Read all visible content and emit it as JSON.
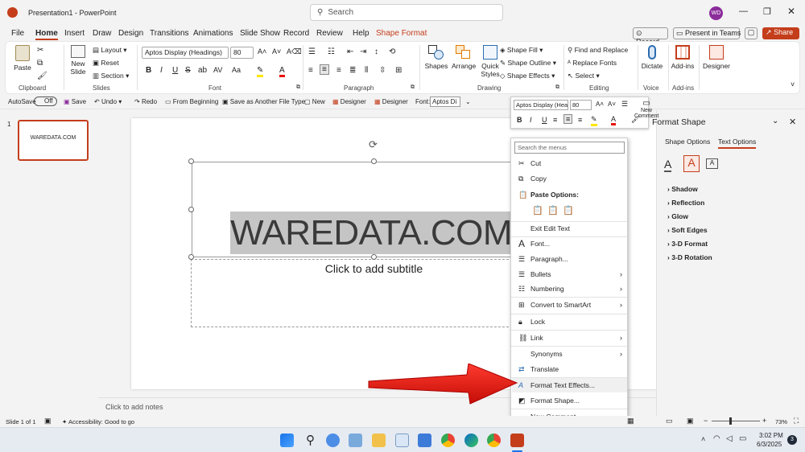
{
  "titlebar": {
    "app_title": "Presentation1  -  PowerPoint",
    "search_placeholder": "Search",
    "avatar": "WD"
  },
  "tabs": [
    "File",
    "Home",
    "Insert",
    "Draw",
    "Design",
    "Transitions",
    "Animations",
    "Slide Show",
    "Record",
    "Review",
    "Help",
    "Shape Format"
  ],
  "ribbon_right": {
    "record": "Record",
    "present": "Present in Teams",
    "share": "Share"
  },
  "ribbon": {
    "paste": "Paste",
    "clipboard": "Clipboard",
    "new_slide_1": "New",
    "new_slide_2": "Slide",
    "layout": "Layout",
    "reset": "Reset",
    "section": "Section",
    "slides": "Slides",
    "font_name": "Aptos Display (Headings)",
    "font_size": "80",
    "font": "Font",
    "paragraph": "Paragraph",
    "shapes": "Shapes",
    "arrange": "Arrange",
    "quick_1": "Quick",
    "quick_2": "Styles",
    "drawing": "Drawing",
    "shape_fill": "Shape Fill",
    "shape_outline": "Shape Outline",
    "shape_effects": "Shape Effects",
    "find_replace": "Find and Replace",
    "replace_fonts": "Replace Fonts",
    "select": "Select",
    "editing": "Editing",
    "dictate": "Dictate",
    "voice": "Voice",
    "addins": "Add-ins",
    "addins_group": "Add-ins",
    "designer": "Designer"
  },
  "qat": {
    "autosave": "AutoSave",
    "off": "Off",
    "save": "Save",
    "undo": "Undo",
    "redo": "Redo",
    "from_beginning": "From Beginning",
    "save_as": "Save as Another File Type",
    "new": "New",
    "designer1": "Designer",
    "designer2": "Designer",
    "font_label": "Font:",
    "font_value": "Aptos Di"
  },
  "slide_panel": {
    "number": "1",
    "thumb_text": "WAREDATA.COM"
  },
  "slide": {
    "title": "WAREDATA.COM",
    "subtitle": "Click to add subtitle"
  },
  "notes": "Click to add notes",
  "mini_toolbar": {
    "font": "Aptos Display (Hea",
    "size": "80",
    "new_comment_1": "New",
    "new_comment_2": "Comment"
  },
  "format_pane": {
    "title": "Format Shape",
    "tab_shape": "Shape Options",
    "tab_text": "Text Options",
    "items": [
      "Shadow",
      "Reflection",
      "Glow",
      "Soft Edges",
      "3-D Format",
      "3-D Rotation"
    ]
  },
  "context_menu": {
    "search_placeholder": "Search the menus",
    "cut": "Cut",
    "copy": "Copy",
    "paste_options": "Paste Options:",
    "exit_edit": "Exit Edit Text",
    "font": "Font...",
    "paragraph": "Paragraph...",
    "bullets": "Bullets",
    "numbering": "Numbering",
    "smartart": "Convert to SmartArt",
    "lock": "Lock",
    "link": "Link",
    "synonyms": "Synonyms",
    "translate": "Translate",
    "format_text_effects": "Format Text Effects...",
    "format_shape": "Format Shape...",
    "new_comment": "New Comment"
  },
  "status": {
    "slide": "Slide 1 of 1",
    "accessibility": "Accessibility: Good to go",
    "zoom": "73%"
  },
  "taskbar": {
    "time": "3:02 PM",
    "date": "6/3/2025",
    "badge": "3"
  },
  "colors": {
    "accent": "#c43e1c",
    "arrow": "#e8140c"
  }
}
